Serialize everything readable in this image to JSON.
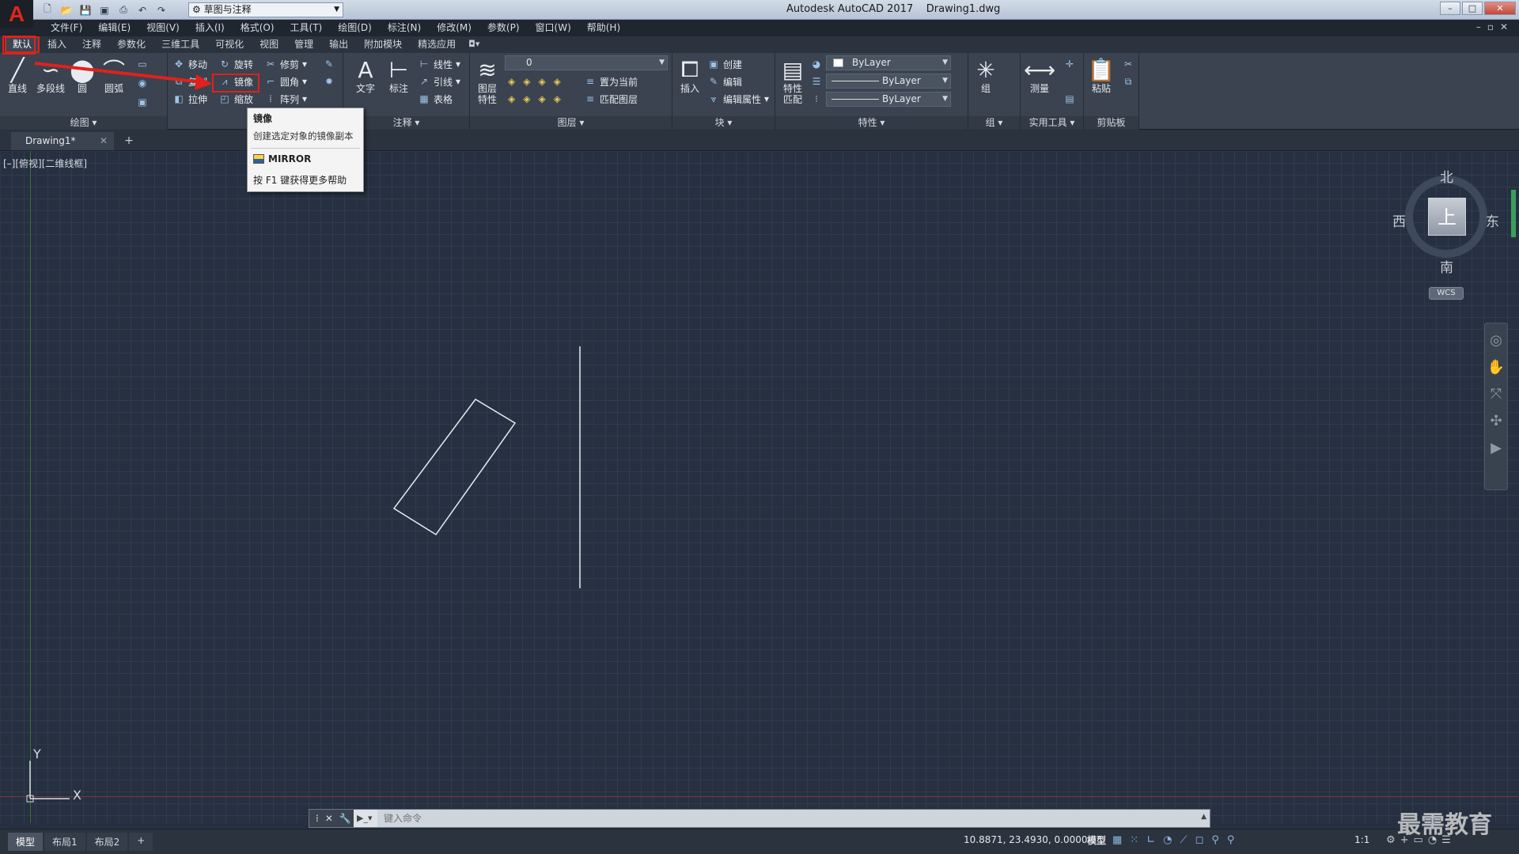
{
  "titlebar": {
    "logo": "A",
    "workspace": "草图与注释",
    "title": "Autodesk AutoCAD 2017    Drawing1.dwg",
    "controls": [
      "–",
      "□",
      "✕"
    ]
  },
  "menu": [
    "文件(F)",
    "编辑(E)",
    "视图(V)",
    "插入(I)",
    "格式(O)",
    "工具(T)",
    "绘图(D)",
    "标注(N)",
    "修改(M)",
    "参数(P)",
    "窗口(W)",
    "帮助(H)"
  ],
  "ribbon_tabs": [
    "默认",
    "插入",
    "注释",
    "参数化",
    "三维工具",
    "可视化",
    "视图",
    "管理",
    "输出",
    "附加模块",
    "精选应用"
  ],
  "ribbon": {
    "draw": {
      "title": "绘图",
      "line": "直线",
      "polyline": "多段线",
      "circle": "圆",
      "arc": "圆弧"
    },
    "modify": {
      "move": "移动",
      "rotate": "旋转",
      "trim": "修剪",
      "copy": "复制",
      "mirror": "镜像",
      "fillet": "圆角",
      "stretch": "拉伸",
      "scale": "缩放",
      "array": "阵列"
    },
    "annotation": {
      "title": "注释",
      "text": "文字",
      "dimension": "标注",
      "linear": "线性",
      "leader": "引线",
      "table": "表格"
    },
    "layers": {
      "title": "图层",
      "props": "图层\n特性",
      "current_layer": "0",
      "make_current": "置为当前",
      "match_layer": "匹配图层"
    },
    "block": {
      "title": "块",
      "insert": "插入",
      "create": "创建",
      "edit": "编辑",
      "edit_attr": "编辑属性"
    },
    "properties": {
      "title": "特性",
      "match": "特性\n匹配",
      "color": "ByLayer",
      "linetype": "ByLayer",
      "lineweight": "ByLayer"
    },
    "groups": {
      "title": "组",
      "group": "组"
    },
    "utilities": {
      "title": "实用工具",
      "measure": "测量"
    },
    "clipboard": {
      "title": "剪贴板",
      "paste": "粘贴"
    }
  },
  "file_tab": {
    "name": "Drawing1*"
  },
  "viewport_label": "[–][俯视][二维线框]",
  "viewcube": {
    "north": "北",
    "south": "南",
    "east": "东",
    "west": "西",
    "top": "上",
    "wcs": "WCS"
  },
  "ucs": {
    "x": "X",
    "y": "Y"
  },
  "tooltip": {
    "title": "镜像",
    "description": "创建选定对象的镜像副本",
    "command": "MIRROR",
    "help": "按 F1 键获得更多帮助"
  },
  "command_line": {
    "placeholder": "键入命令"
  },
  "status": {
    "layouts": [
      "模型",
      "布局1",
      "布局2"
    ],
    "coords": "10.8871, 23.4930, 0.0000",
    "space": "模型",
    "scale": "1:1"
  },
  "watermark": "最需教育",
  "colors": {
    "highlight": "#e0211c",
    "canvas": "#263040",
    "ribbon": "#3a434f"
  }
}
